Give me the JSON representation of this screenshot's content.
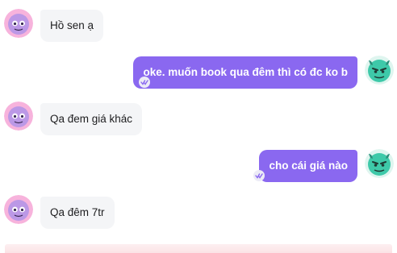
{
  "chat": {
    "messages": [
      {
        "sender": "other",
        "text": "Hồ sen ạ",
        "avatar": "purple-monster-avatar"
      },
      {
        "sender": "me",
        "text": "oke. muốn book qua đêm thì có đc ko b",
        "avatar": "green-monster-avatar",
        "status_icon": "read-check-icon"
      },
      {
        "sender": "other",
        "text": "Qa đem giá khác",
        "avatar": "purple-monster-avatar"
      },
      {
        "sender": "me",
        "text": "cho cái giá nào",
        "avatar": "green-monster-avatar",
        "status_icon": "read-check-icon"
      },
      {
        "sender": "other",
        "text": "Qa đêm 7tr",
        "avatar": "purple-monster-avatar"
      }
    ]
  },
  "colors": {
    "outgoing_bubble": "#8a68f0",
    "incoming_bubble": "#f4f5f7",
    "incoming_text": "#1d1d1f",
    "outgoing_text": "#ffffff",
    "left_avatar_ring": "#f7b3dc",
    "left_avatar_face": "#bb98e6",
    "right_avatar_face": "#3ec9a9",
    "read_icon": "#8a68f0"
  }
}
